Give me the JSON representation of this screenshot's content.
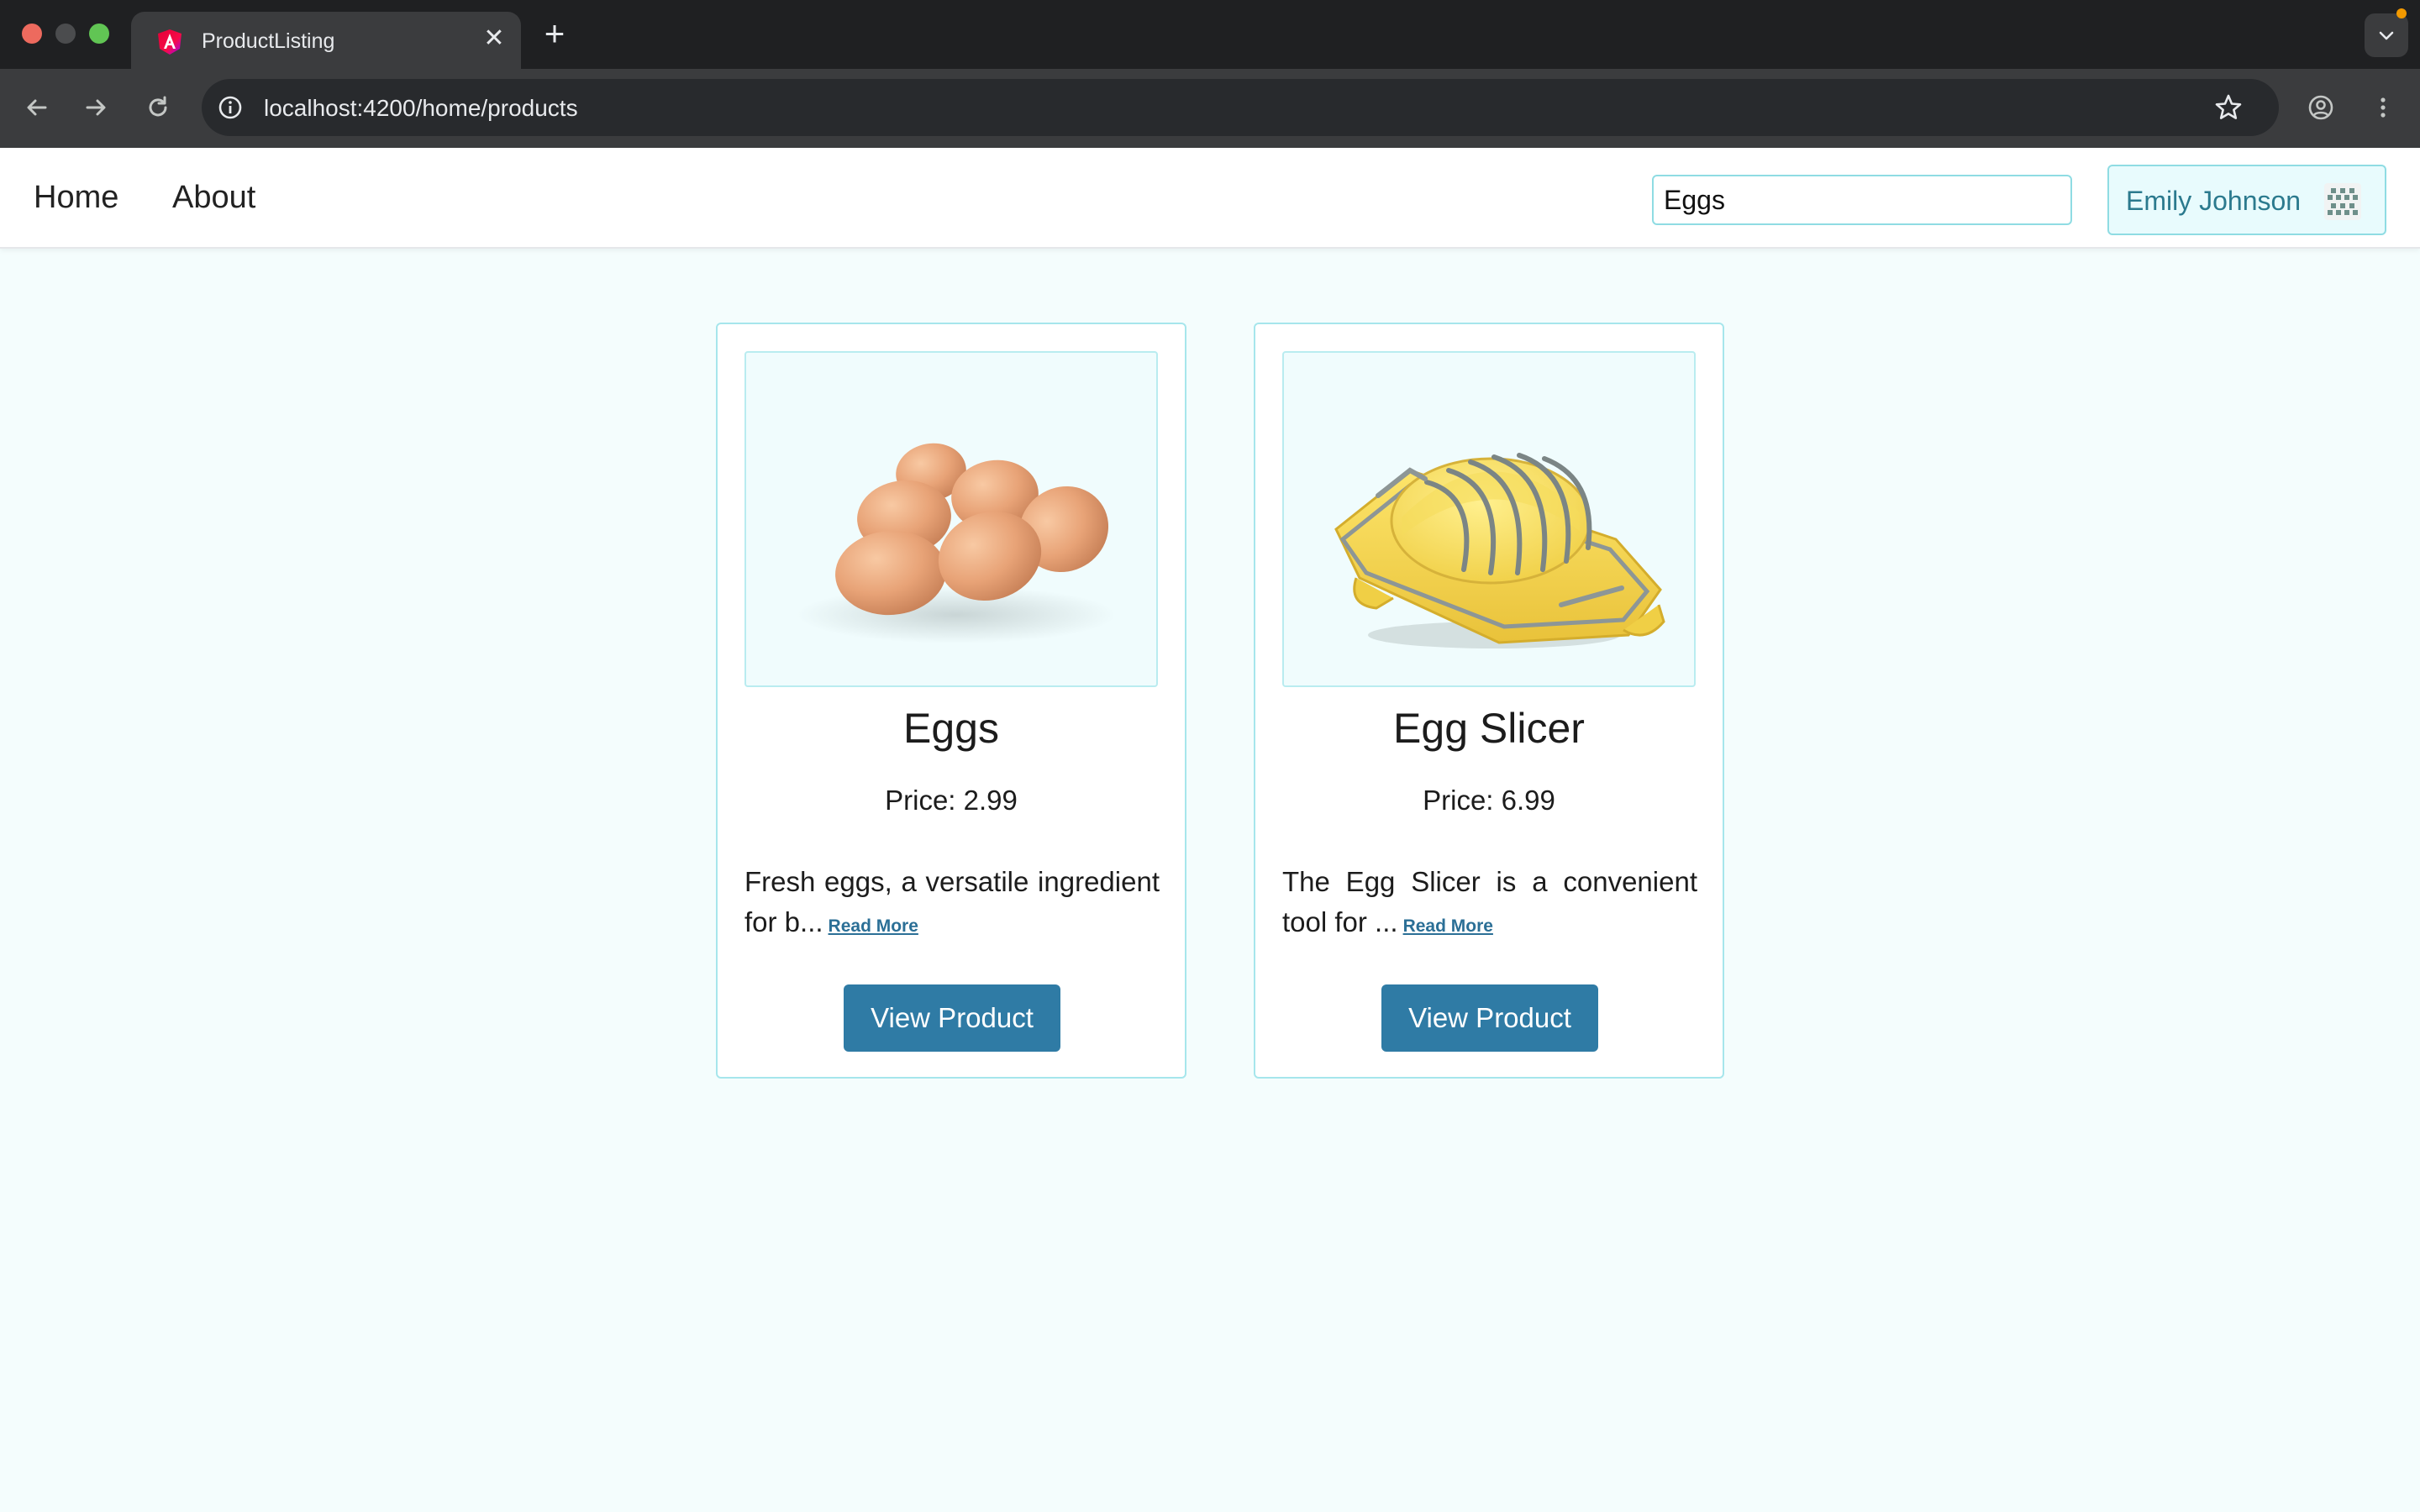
{
  "browser": {
    "tab_title": "ProductListing",
    "tab_close": "✕",
    "new_tab": "+",
    "url": "localhost:4200/home/products"
  },
  "header": {
    "nav": [
      {
        "label": "Home"
      },
      {
        "label": "About"
      }
    ],
    "search": {
      "value": "Eggs"
    },
    "user": {
      "name": "Emily Johnson"
    }
  },
  "products": [
    {
      "name": "Eggs",
      "price_text": "Price: 2.99",
      "description": "Fresh eggs, a versatile ingredient for b...",
      "read_more": "Read More",
      "button": "View Product"
    },
    {
      "name": "Egg Slicer",
      "price_text": "Price: 6.99",
      "description": "The Egg Slicer is a convenient tool for ...",
      "read_more": "Read More",
      "button": "View Product"
    }
  ],
  "colors": {
    "page_bg": "#f4fdfd",
    "accent": "#2f7ba5",
    "card_border": "#a6e6ec",
    "user_chip_bg": "#e8fbfd"
  }
}
